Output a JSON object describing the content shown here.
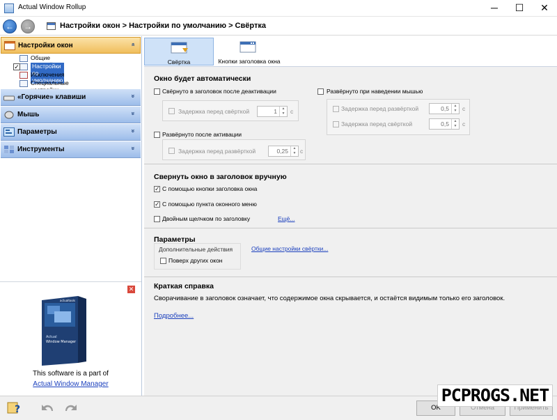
{
  "window": {
    "title": "Actual Window Rollup",
    "minimize": "─",
    "maximize": "☐",
    "close": "✕"
  },
  "nav": {
    "back": "←",
    "forward": "→",
    "breadcrumb": "Настройки окон > Настройки по умолчанию > Свёртка"
  },
  "sidebar": {
    "categories": [
      {
        "label": "Настройки окон",
        "chevron": "»"
      },
      {
        "label": "«Горячие» клавиши",
        "chevron": "»"
      },
      {
        "label": "Мышь",
        "chevron": "»"
      },
      {
        "label": "Параметры",
        "chevron": "»"
      },
      {
        "label": "Инструменты",
        "chevron": "»"
      }
    ],
    "items": [
      {
        "label": "Общие настройки"
      },
      {
        "label": "Настройки по умолчанию",
        "checked": "✓"
      },
      {
        "label": "Исключения"
      },
      {
        "label": "Специальные настройки"
      }
    ]
  },
  "promo": {
    "close": "✕",
    "box_brand": "actualtools",
    "box_title_line1": "Actual",
    "box_title_line2": "Window Manager",
    "text": "This software is a part of",
    "link": "Actual Window Manager"
  },
  "tabs": [
    {
      "label": "Свёртка"
    },
    {
      "label": "Кнопки заголовка окна"
    }
  ],
  "auto": {
    "title": "Окно будет автоматически",
    "rolled_after_deactivation": "Свёрнуто в заголовок после деактивации",
    "delay_before_rollup": "Задержка перед свёрткой",
    "delay_before_rollup_value": "1",
    "seconds_unit": "с",
    "unrolled_after_activation": "Развёрнуто после активации",
    "delay_before_unroll": "Задержка перед развёрткой",
    "delay_before_unroll_value": "0,25",
    "unrolled_on_hover": "Развёрнуто при наведении мышью",
    "hover_delay_unroll": "Задержка перед развёрткой",
    "hover_delay_unroll_value": "0,5",
    "hover_delay_rollup": "Задержка перед свёрткой",
    "hover_delay_rollup_value": "0,5"
  },
  "manual": {
    "title": "Свернуть окно в заголовок вручную",
    "via_title_button": "С помощью кнопки заголовка окна",
    "via_window_menu": "С помощью пункта оконного меню",
    "double_click": "Двойным щелчком по заголовку",
    "more_link": "Ещё...",
    "checkmark": "✓"
  },
  "params": {
    "title": "Параметры",
    "extra_actions": "Дополнительные действия",
    "on_top": "Поверх других окон",
    "general_link": "Общие настройки свёртки..."
  },
  "help": {
    "title": "Краткая справка",
    "text": "Сворачивание в заголовок означает, что содержимое окна скрывается, и остаётся видимым только его заголовок.",
    "more_link": "Подробнее..."
  },
  "buttons": {
    "ok": "OK",
    "cancel": "Отмена",
    "apply": "Применить"
  },
  "watermark": "PCPROGS.NET"
}
